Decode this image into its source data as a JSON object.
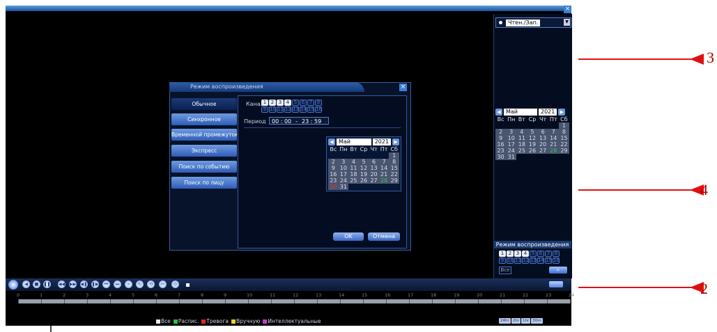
{
  "window": {
    "close_glyph": "×"
  },
  "right_panel": {
    "mode_value": "Чтен./Зап.",
    "calendar": {
      "month": "Май",
      "year": "2021",
      "weekdays": [
        "Вс",
        "Пн",
        "Вт",
        "Ср",
        "Чт",
        "Пт",
        "Сб"
      ],
      "days": [
        "",
        "",
        "",
        "",
        "",
        "",
        "1",
        "2",
        "3",
        "4",
        "5",
        "6",
        "7",
        "8",
        "9",
        "10",
        "11",
        "12",
        "13",
        "14",
        "15",
        "16",
        "17",
        "18",
        "19",
        "20",
        "21",
        "22",
        "23",
        "24",
        "25",
        "26",
        "27",
        "28",
        "29",
        "30",
        "31"
      ],
      "today": "28"
    },
    "playback_title": "Режим воспроизведения",
    "channels_row1": [
      "1",
      "2",
      "3",
      "4",
      "5",
      "6",
      "7",
      "8"
    ],
    "channels_row2": [
      "9",
      "10",
      "11",
      "12",
      "13",
      "14",
      "15",
      "16"
    ],
    "all_label": "Все"
  },
  "dialog": {
    "title": "Режим воспроизведения",
    "side_buttons": [
      "Обычное",
      "Синхронное",
      "Временной промежуток",
      "Экспресс",
      "Поиск по событию",
      "Поиск по лицу"
    ],
    "channel_label": "Канал",
    "channels_row1": [
      "1",
      "2",
      "3",
      "4",
      "5",
      "6",
      "7",
      "8"
    ],
    "channels_row2": [
      "9",
      "10",
      "11",
      "12",
      "13",
      "14",
      "15",
      "16"
    ],
    "period_label": "Период",
    "period_start": "00 : 00",
    "period_dash": "-",
    "period_end": "23 : 59",
    "calendar": {
      "month": "Май",
      "year": "2021",
      "weekdays": [
        "Вс",
        "Пн",
        "Вт",
        "Ср",
        "Чт",
        "Пт",
        "Сб"
      ],
      "days": [
        "",
        "",
        "",
        "",
        "",
        "",
        "1",
        "2",
        "3",
        "4",
        "5",
        "6",
        "7",
        "8",
        "9",
        "10",
        "11",
        "12",
        "13",
        "14",
        "15",
        "16",
        "17",
        "18",
        "19",
        "20",
        "21",
        "22",
        "23",
        "24",
        "25",
        "26",
        "27",
        "28",
        "29",
        "30",
        "31"
      ],
      "today": "28",
      "selected": "30"
    },
    "ok_label": "OK",
    "cancel_label": "Отмена"
  },
  "timeline": {
    "hours": [
      "0",
      "1",
      "2",
      "3",
      "4",
      "5",
      "6",
      "7",
      "8",
      "9",
      "10",
      "11",
      "12",
      "13",
      "14",
      "15",
      "16",
      "17",
      "18",
      "19",
      "20",
      "21",
      "22",
      "23",
      "24"
    ]
  },
  "legend": [
    {
      "label": "Все",
      "color": "#e8e8e8"
    },
    {
      "label": "Распис.",
      "color": "#2fbf3a"
    },
    {
      "label": "Тревога",
      "color": "#d42a2a"
    },
    {
      "label": "Вручную",
      "color": "#e8d02a"
    },
    {
      "label": "Интеллектуальные",
      "color": "#c83ac8"
    }
  ],
  "zoom": [
    "24hr",
    "2hr",
    "1hr",
    "30m"
  ],
  "annotations": {
    "n3": "3",
    "n4": "4",
    "n2": "2"
  }
}
